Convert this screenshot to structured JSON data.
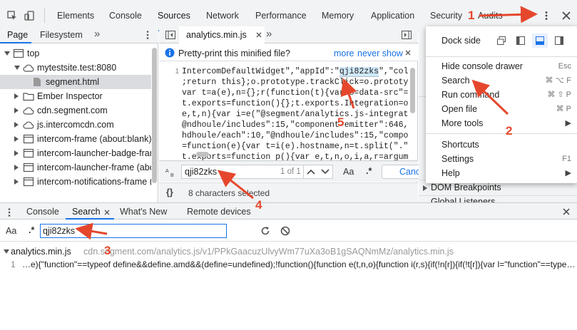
{
  "main_tabs": [
    "Elements",
    "Console",
    "Sources",
    "Network",
    "Performance",
    "Memory",
    "Application",
    "Security",
    "Audits"
  ],
  "left_tabs": {
    "page": "Page",
    "filesystem": "Filesystem",
    "more": "»"
  },
  "tree": [
    {
      "label": "top",
      "indent": 0,
      "twisty": "down",
      "icon": "frame"
    },
    {
      "label": "mytestsite.test:8080",
      "indent": 1,
      "twisty": "down",
      "icon": "cloud"
    },
    {
      "label": "segment.html",
      "indent": 2,
      "twisty": "",
      "icon": "file",
      "selected": true
    },
    {
      "label": "Ember Inspector",
      "indent": 1,
      "twisty": "right",
      "icon": "folder"
    },
    {
      "label": "cdn.segment.com",
      "indent": 1,
      "twisty": "right",
      "icon": "cloud"
    },
    {
      "label": "js.intercomcdn.com",
      "indent": 1,
      "twisty": "right",
      "icon": "cloud"
    },
    {
      "label": "intercom-frame (about:blank)",
      "indent": 1,
      "twisty": "right",
      "icon": "frame"
    },
    {
      "label": "intercom-launcher-badge-fram",
      "indent": 1,
      "twisty": "right",
      "icon": "frame"
    },
    {
      "label": "intercom-launcher-frame (abo",
      "indent": 1,
      "twisty": "right",
      "icon": "frame"
    },
    {
      "label": "intercom-notifications-frame (a",
      "indent": 1,
      "twisty": "right",
      "icon": "frame"
    }
  ],
  "editor": {
    "tab_label": "analytics.min.js",
    "more": "»",
    "prettyprint_msg": "Pretty-print this minified file?",
    "prettyprint_more": "more",
    "prettyprint_never": "never show",
    "line_number": "1",
    "code_lines": [
      {
        "pre": "IntercomDefaultWidget\",\"appId\":\"",
        "hl": "qji82zks",
        "post": "\",\"coll"
      },
      {
        "pre": ";return this};o.prototype.trackClick=o.prototyp",
        "hl": "",
        "post": ""
      },
      {
        "pre": "var t=a(e),n={};r(function(t){var o=data-src\"==",
        "hl": "",
        "post": ""
      },
      {
        "pre": "t.exports=function(){};t.exports.Integration=o(\"",
        "hl": "",
        "post": ""
      },
      {
        "pre": "e,t,n){var i=e(\"@segment/analytics.js-integrati",
        "hl": "",
        "post": ""
      },
      {
        "pre": "@ndhoule/includes\":15,\"component-emitter\":646,\"d",
        "hl": "",
        "post": ""
      },
      {
        "pre": "hdhoule/each\":10,\"@ndhoule/includes\":15,\"componen",
        "hl": "",
        "post": ""
      },
      {
        "pre": "=function(e){var t=i(e).hostname,n=t.split(\".\")",
        "hl": "",
        "post": ""
      },
      {
        "pre": "t.exports=function p(){var e,t,n,o,i,a,r=argume",
        "hl": "",
        "post": ""
      }
    ],
    "find_query": "qji82zks",
    "find_count": "1 of 1",
    "find_aa": "Aa",
    "find_regex": ".*",
    "find_cancel": "Canc",
    "status_braces": "{}",
    "status_text": "8 characters selected"
  },
  "right_panel": {
    "dom_breakpoints": "DOM Breakpoints",
    "global_listeners": "Global Listeners"
  },
  "menu": {
    "dock_side_label": "Dock side",
    "items": [
      {
        "label": "Hide console drawer",
        "shortcut": "Esc"
      },
      {
        "label": "Search",
        "shortcut": "⌘ ⌥ F"
      },
      {
        "label": "Run command",
        "shortcut": "⌘ ⇧ P"
      },
      {
        "label": "Open file",
        "shortcut": "⌘ P"
      },
      {
        "label": "More tools",
        "shortcut": "▶"
      },
      {
        "label": "Shortcuts",
        "shortcut": ""
      },
      {
        "label": "Settings",
        "shortcut": "F1"
      },
      {
        "label": "Help",
        "shortcut": "▶"
      }
    ]
  },
  "drawer": {
    "tabs": [
      "Console",
      "Search",
      "What's New",
      "Remote devices"
    ],
    "search_aa": "Aa",
    "search_regex": ".*",
    "search_query": "qji82zks",
    "result_file": "analytics.min.js",
    "result_url": "cdn.segment.com/analytics.js/v1/PPkGaacuzUlvyWm77uXa3oB1gSAQNmMz/analytics.min.js",
    "result_line_num": "1",
    "result_line": "…e){\"function\"==typeof define&&define.amd&&(define=undefined);!function(){function e(t,n,o){function i(r,s){if(!n[r]){if(!t[r]){var l=\"function\"==type…"
  },
  "annotations": {
    "n1": "1",
    "n2": "2",
    "n3": "3",
    "n4": "4",
    "n5": "5"
  },
  "colors": {
    "accent": "#1a73e8",
    "annotation": "#e5472d"
  }
}
